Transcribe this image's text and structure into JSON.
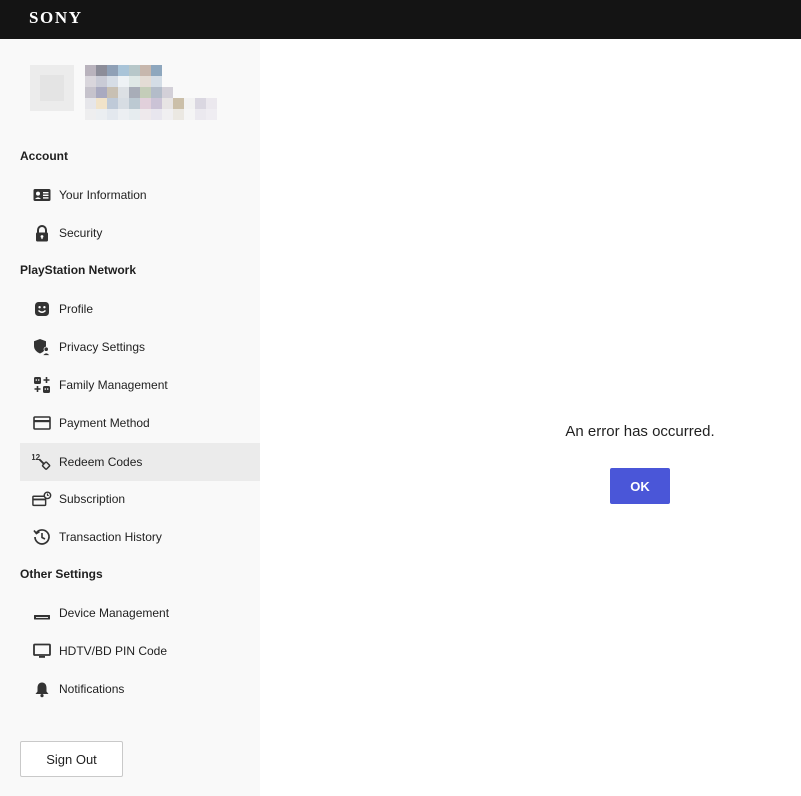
{
  "header": {
    "logo": "SONY"
  },
  "sidebar": {
    "sections": {
      "account": "Account",
      "psn": "PlayStation Network",
      "other": "Other Settings"
    },
    "items": {
      "your_information": "Your Information",
      "security": "Security",
      "profile": "Profile",
      "privacy_settings": "Privacy Settings",
      "family_management": "Family Management",
      "payment_method": "Payment Method",
      "redeem_codes": "Redeem Codes",
      "subscription": "Subscription",
      "transaction_history": "Transaction History",
      "device_management": "Device Management",
      "hdtv_pin": "HDTV/BD PIN Code",
      "notifications": "Notifications"
    },
    "active_item": "redeem_codes",
    "sign_out": "Sign Out"
  },
  "main": {
    "error_message": "An error has occurred.",
    "ok_button": "OK"
  },
  "colors": {
    "topbar": "#141414",
    "sidebar": "#f9f9f9",
    "active_item": "#ebebeb",
    "ok_button": "#4a56d8"
  }
}
